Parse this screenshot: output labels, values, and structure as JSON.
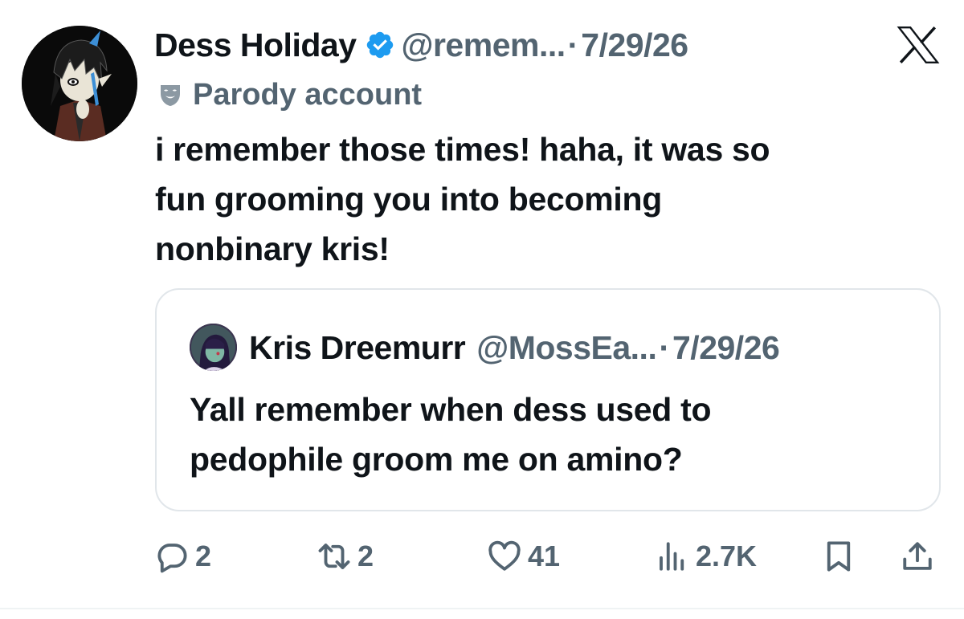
{
  "author": {
    "display_name": "Dess Holiday",
    "handle": "@remem...",
    "separator": "·",
    "date": "7/29/26",
    "badge_label": "Parody account"
  },
  "tweet": {
    "lines": [
      "i remember those times! haha, it was so",
      "fun grooming you into becoming",
      "nonbinary kris!"
    ]
  },
  "quote": {
    "display_name": "Kris Dreemurr",
    "handle": "@MossEa...",
    "separator": "·",
    "date": "7/29/26",
    "lines": [
      "Yall remember when dess used to",
      "pedophile groom me on amino?"
    ]
  },
  "actions": {
    "reply_count": "2",
    "retweet_count": "2",
    "like_count": "41",
    "views_count": "2.7K"
  },
  "icons": {
    "brand": "x-logo-icon",
    "verified": "verified-badge-icon",
    "parody": "theater-mask-icon",
    "reply": "reply-icon",
    "retweet": "retweet-icon",
    "like": "heart-icon",
    "views": "views-icon",
    "bookmark": "bookmark-icon",
    "share": "share-icon"
  },
  "colors": {
    "text_primary": "#0f1419",
    "text_secondary": "#536471",
    "verified_blue": "#1d9bf0",
    "border": "#e1e6ea"
  }
}
